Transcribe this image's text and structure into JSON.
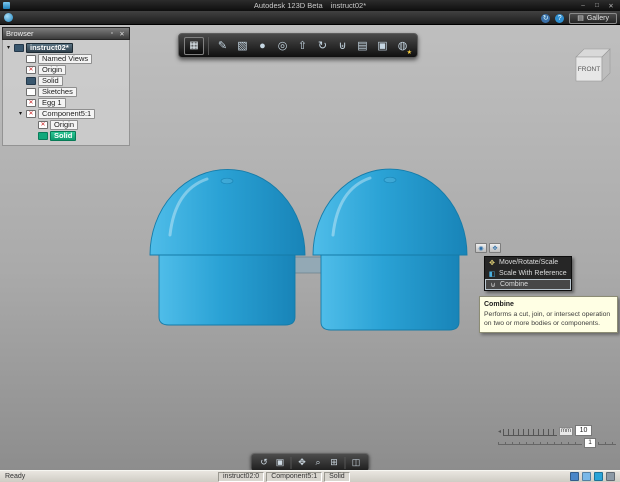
{
  "titlebar": {
    "app_title": "Autodesk 123D Beta",
    "doc_title": "instruct02*",
    "minimize": "–",
    "maximize": "□",
    "close": "✕"
  },
  "menubar": {
    "gallery_label": "Gallery",
    "help_glyph": "?",
    "sync_glyph": "↻"
  },
  "browser": {
    "title": "Browser",
    "items": [
      {
        "label": "instruct02*"
      },
      {
        "label": "Named Views"
      },
      {
        "label": "Origin"
      },
      {
        "label": "Solid"
      },
      {
        "label": "Sketches"
      },
      {
        "label": "Egg 1"
      },
      {
        "label": "Component5:1"
      },
      {
        "label": "Origin"
      },
      {
        "label": "Solid"
      }
    ]
  },
  "viewcube": {
    "face": "FRONT"
  },
  "context_menu": {
    "items": [
      {
        "label": "Move/Rotate/Scale"
      },
      {
        "label": "Scale With Reference"
      },
      {
        "label": "Combine"
      }
    ],
    "selected_index": 2
  },
  "tooltip": {
    "title": "Combine",
    "body": "Performs a cut, join, or intersect operation on two or more bodies or components."
  },
  "ruler": {
    "unit": "mm",
    "value": "10",
    "sub_value": "1"
  },
  "statusbar": {
    "ready": "Ready",
    "doc": "instruct02:0",
    "component": "Component5:1",
    "solid": "Solid"
  },
  "colors": {
    "model_blue": "#2ba3d6",
    "selection_green": "#14b489",
    "tooltip_bg": "#ffffe4"
  },
  "icons": {
    "app_cube": "▦",
    "sketch": "✎",
    "box": "▧",
    "sphere": "●",
    "cylinder": "◎",
    "extrude": "⇧",
    "revolve": "↻",
    "combine": "⊎",
    "pattern": "▤",
    "group": "▣",
    "material": "◍",
    "star": "★",
    "tri_down": "▾",
    "red_x": "✕",
    "browser_pin": "▫",
    "browser_close": "✕",
    "menu_move": "✥",
    "menu_scale": "◧",
    "menu_combine": "⊎",
    "mini_pivot": "◉",
    "mini_move": "✥",
    "orbit": "↺",
    "view_cube": "▣",
    "pan": "✥",
    "zoom": "⌕",
    "fit": "⊞",
    "display": "◫",
    "ruler_arrow": "◂",
    "gallery": "▤"
  }
}
